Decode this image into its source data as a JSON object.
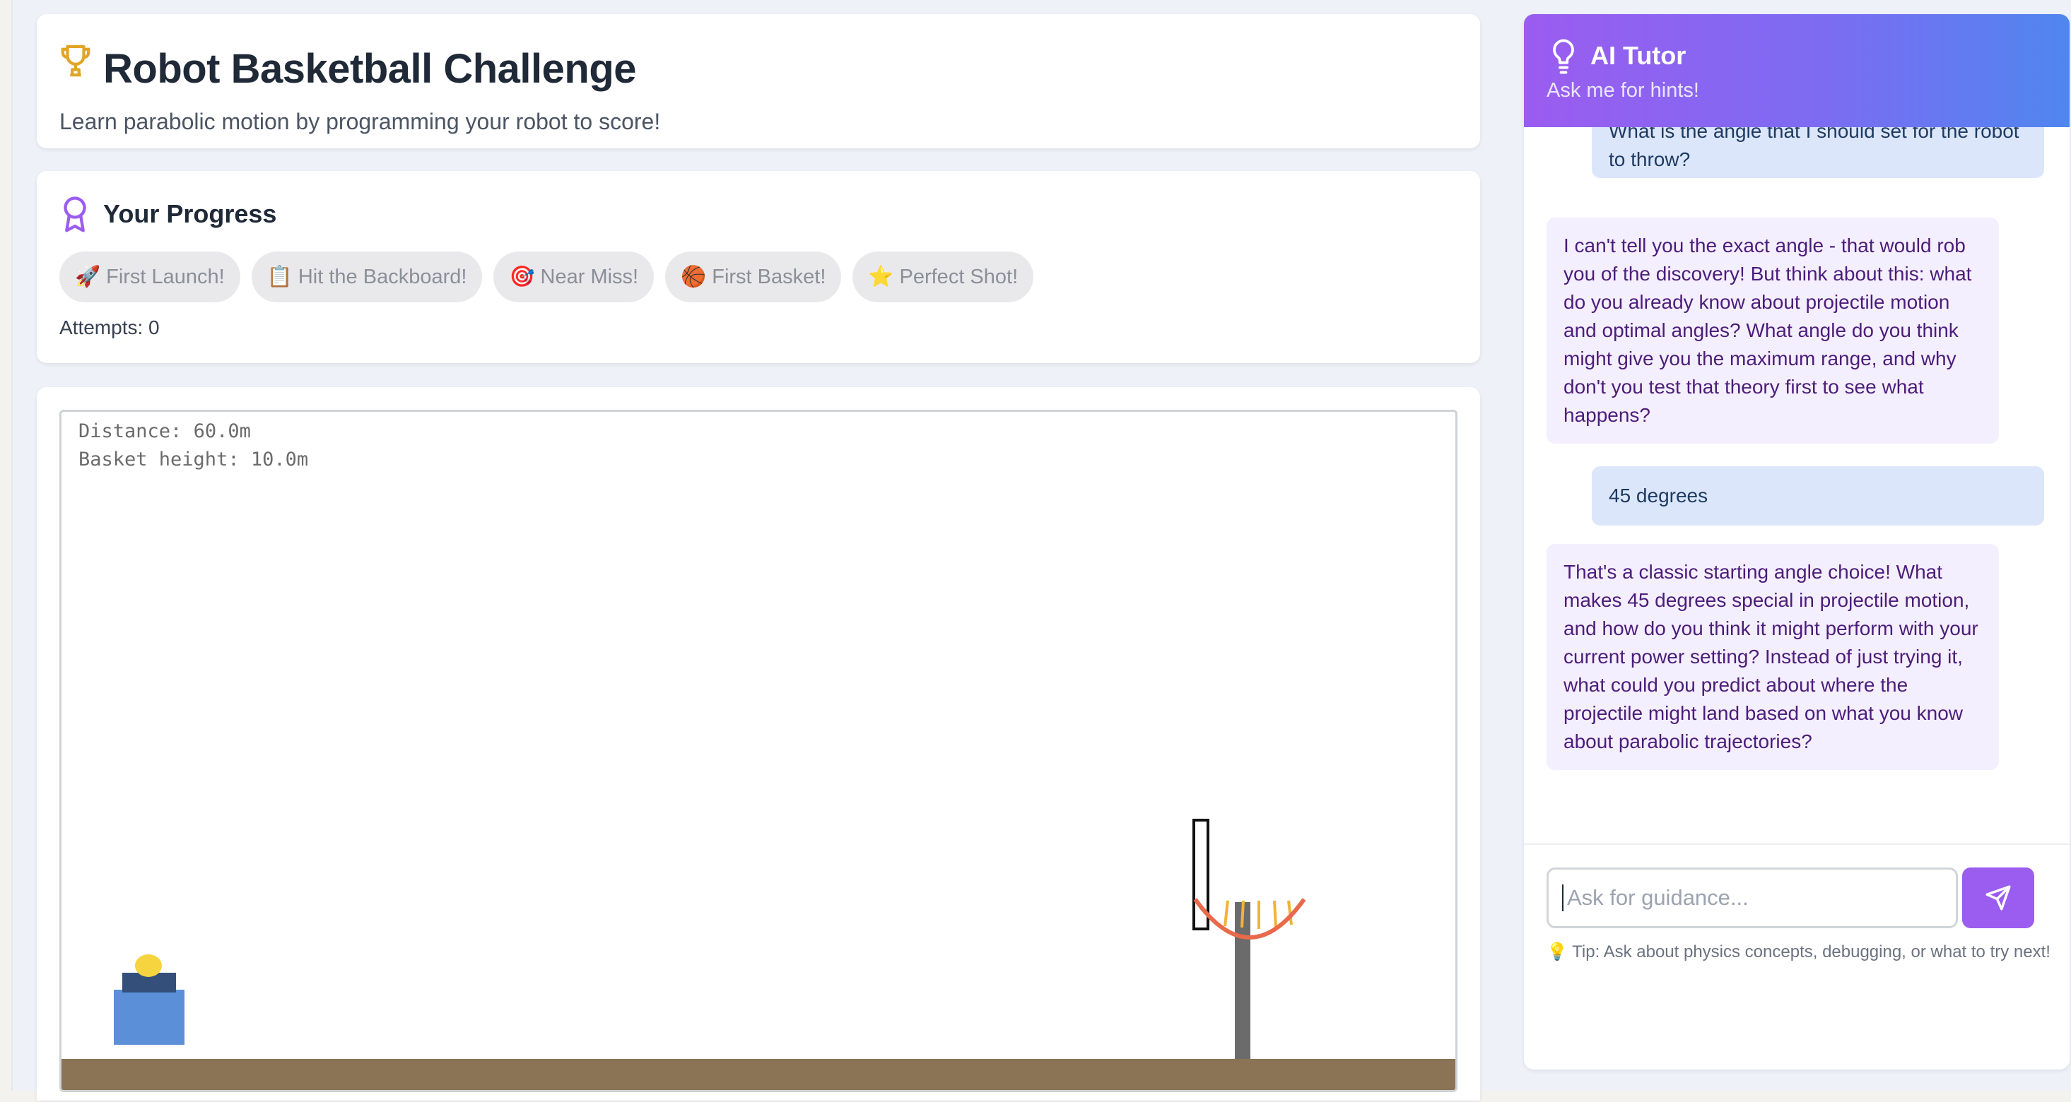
{
  "header": {
    "title": "Robot Basketball Challenge",
    "subtitle": "Learn parabolic motion by programming your robot to score!",
    "icon": "trophy-icon"
  },
  "progress": {
    "title": "Your Progress",
    "icon": "ribbon-icon",
    "badges": [
      {
        "emoji": "🚀",
        "label": "First Launch!"
      },
      {
        "emoji": "📋",
        "label": "Hit the Backboard!"
      },
      {
        "emoji": "🎯",
        "label": "Near Miss!"
      },
      {
        "emoji": "🏀",
        "label": "First Basket!"
      },
      {
        "emoji": "⭐",
        "label": "Perfect Shot!"
      }
    ],
    "attempts_label": "Attempts:",
    "attempts_value": "0"
  },
  "game": {
    "distance_label": "Distance:",
    "distance_value": "60.0m",
    "height_label": "Basket height:",
    "height_value": "10.0m",
    "colors": {
      "ground": "#8b7355",
      "robot": "#5b8fd8",
      "ball": "#f6d43f",
      "rim": "#e86a4a"
    }
  },
  "tutor": {
    "title": "AI Tutor",
    "subtitle": "Ask me for hints!",
    "messages": [
      {
        "role": "user",
        "text": "What is the angle that I should set for the robot to throw?"
      },
      {
        "role": "tutor",
        "text": "I can't tell you the exact angle - that would rob you of the discovery! But think about this: what do you already know about projectile motion and optimal angles? What angle do you think might give you the maximum range, and why don't you test that theory first to see what happens?"
      },
      {
        "role": "user",
        "text": "45 degrees"
      },
      {
        "role": "tutor",
        "text": "That's a classic starting angle choice! What makes 45 degrees special in projectile motion, and how do you think it might perform with your current power setting? Instead of just trying it, what could you predict about where the projectile might land based on what you know about parabolic trajectories?"
      }
    ],
    "input_placeholder": "Ask for guidance...",
    "input_value": "",
    "tip": "💡 Tip: Ask about physics concepts, debugging, or what to try next!",
    "accent": "#9b5cf0"
  }
}
